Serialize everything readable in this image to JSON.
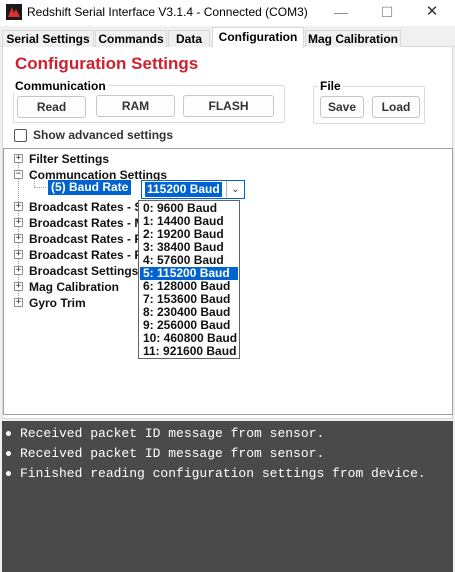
{
  "window": {
    "title": "Redshift Serial Interface V3.1.4 - Connected (COM3)",
    "minimize": "—",
    "maximize": "☐",
    "close": "✕"
  },
  "tabs": [
    {
      "label": "Serial Settings",
      "active": false
    },
    {
      "label": "Commands",
      "active": false
    },
    {
      "label": "Data",
      "active": false
    },
    {
      "label": "Configuration",
      "active": true
    },
    {
      "label": "Mag Calibration",
      "active": false
    }
  ],
  "configuration": {
    "title": "Configuration Settings",
    "communication": {
      "label": "Communication",
      "buttons": [
        "Read",
        "RAM",
        "FLASH"
      ]
    },
    "file": {
      "label": "File",
      "buttons": [
        "Save",
        "Load"
      ]
    },
    "show_advanced": {
      "label": "Show advanced settings",
      "checked": false
    }
  },
  "tree": {
    "items": [
      {
        "label": "Filter Settings",
        "expanded": false
      },
      {
        "label": "Communcation Settings",
        "expanded": true
      },
      {
        "label": "(5) Baud Rate",
        "selected": true
      },
      {
        "label": "Broadcast Rates - S",
        "expanded": false
      },
      {
        "label": "Broadcast Rates - M",
        "expanded": false
      },
      {
        "label": "Broadcast Rates - R",
        "expanded": false
      },
      {
        "label": "Broadcast Rates - R",
        "expanded": false
      },
      {
        "label": "Broadcast Settings",
        "expanded": false
      },
      {
        "label": "Mag Calibration",
        "expanded": false
      },
      {
        "label": "Gyro Trim",
        "expanded": false
      }
    ],
    "expander_collapsed": "+",
    "expander_expanded": "−"
  },
  "baud_combo": {
    "value": "115200 Baud",
    "arrow": "⌄"
  },
  "baud_options": [
    "0: 9600 Baud",
    "1: 14400 Baud",
    "2: 19200 Baud",
    "3: 38400 Baud",
    "4: 57600 Baud",
    "5: 115200 Baud",
    "6: 128000 Baud",
    "7: 153600 Baud",
    "8: 230400 Baud",
    "9: 256000 Baud",
    "10: 460800 Baud",
    "11: 921600 Baud"
  ],
  "baud_selected_index": 5,
  "console": {
    "lines": [
      "Received packet ID message from sensor.",
      "Received packet ID message from sensor.",
      "Finished reading configuration settings from device."
    ]
  },
  "colors": {
    "accent_red": "#d0202e",
    "selection_blue": "#0063d1",
    "console_bg": "#4a4a4a"
  }
}
